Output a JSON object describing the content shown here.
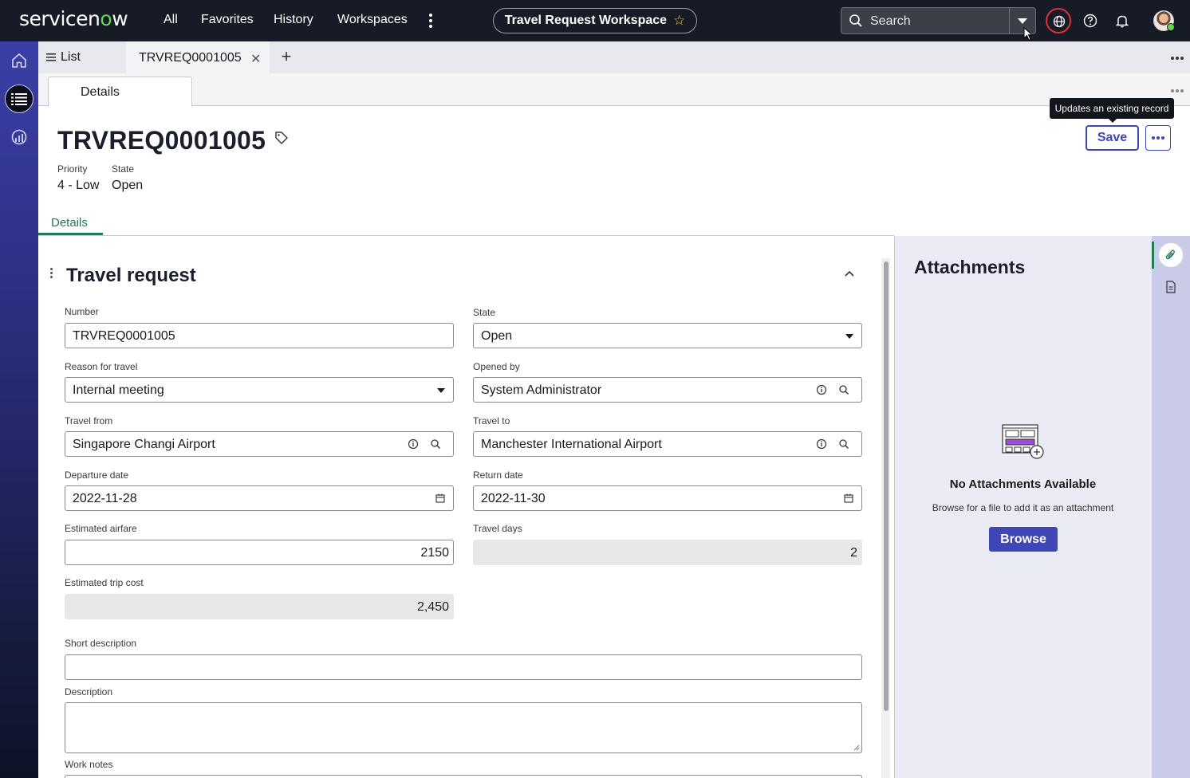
{
  "header": {
    "logo_text_a": "servicen",
    "logo_text_o": "o",
    "logo_text_b": "w",
    "nav": [
      "All",
      "Favorites",
      "History",
      "Workspaces"
    ],
    "workspace_title": "Travel Request Workspace",
    "search_placeholder": "Search"
  },
  "tabs": {
    "list_label": "List",
    "record_tab": "TRVREQ0001005",
    "sub_tab": "Details"
  },
  "record": {
    "title": "TRVREQ0001005",
    "meta": [
      {
        "label": "Priority",
        "value": "4 - Low"
      },
      {
        "label": "State",
        "value": "Open"
      }
    ],
    "tooltip": "Updates an existing record",
    "save_label": "Save",
    "details_tab": "Details"
  },
  "form": {
    "section_title": "Travel request",
    "number": {
      "label": "Number",
      "value": "TRVREQ0001005"
    },
    "state": {
      "label": "State",
      "value": "Open"
    },
    "reason": {
      "label": "Reason for travel",
      "value": "Internal meeting"
    },
    "opened_by": {
      "label": "Opened by",
      "value": "System Administrator"
    },
    "travel_from": {
      "label": "Travel from",
      "value": "Singapore Changi Airport"
    },
    "travel_to": {
      "label": "Travel to",
      "value": "Manchester International Airport"
    },
    "departure": {
      "label": "Departure date",
      "value": "2022-11-28"
    },
    "return": {
      "label": "Return date",
      "value": "2022-11-30"
    },
    "airfare": {
      "label": "Estimated airfare",
      "value": "2150"
    },
    "travel_days": {
      "label": "Travel days",
      "value": "2"
    },
    "trip_cost": {
      "label": "Estimated trip cost",
      "value": "2,450"
    },
    "short_description": {
      "label": "Short description",
      "value": ""
    },
    "description": {
      "label": "Description",
      "value": ""
    },
    "work_notes": {
      "label": "Work notes"
    }
  },
  "attachments": {
    "title": "Attachments",
    "empty_title": "No Attachments Available",
    "empty_hint": "Browse for a file to add it as an attachment",
    "browse_label": "Browse"
  },
  "colors": {
    "header_bg": "#161b26",
    "accent": "#3c47b4",
    "tab_green": "#1f7a53",
    "logo_green": "#62d84e"
  }
}
